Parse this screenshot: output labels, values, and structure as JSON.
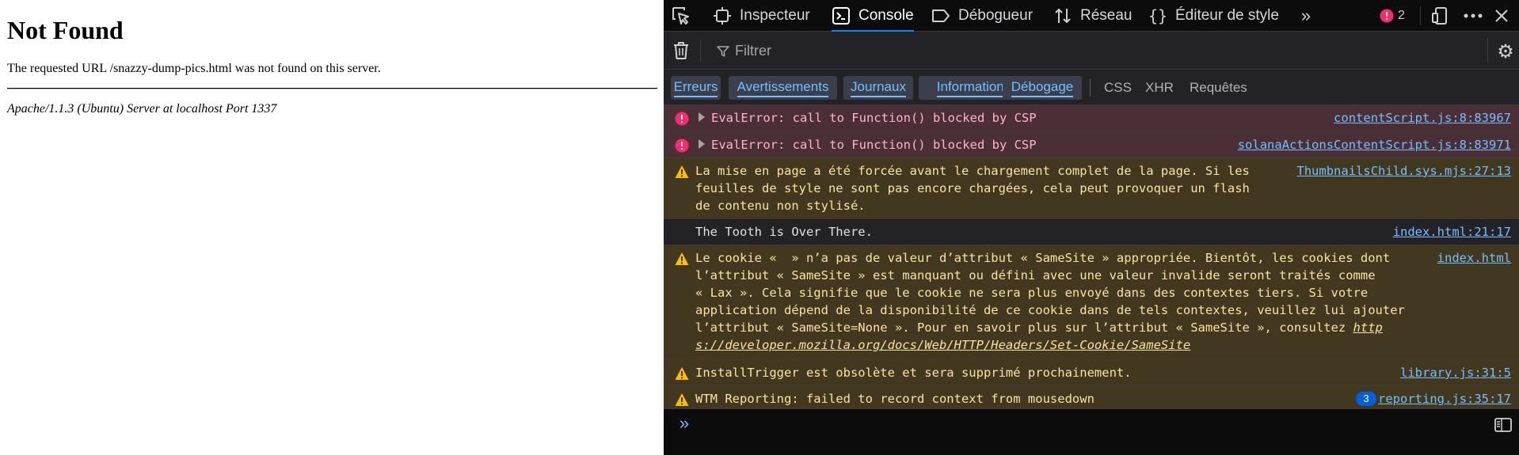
{
  "page": {
    "title": "Not Found",
    "message": "The requested URL /snazzy-dump-pics.html was not found on this server.",
    "address": "Apache/1.1.3 (Ubuntu) Server at localhost Port 1337"
  },
  "devtools": {
    "tabs": [
      {
        "label": "Inspecteur",
        "icon": "inspector-icon"
      },
      {
        "label": "Console",
        "icon": "console-icon",
        "active": true
      },
      {
        "label": "Débogueur",
        "icon": "debugger-icon"
      },
      {
        "label": "Réseau",
        "icon": "network-icon"
      },
      {
        "label": "Éditeur de style",
        "icon": "style-editor-icon"
      }
    ],
    "error_count": "2",
    "filter_placeholder": "Filtrer",
    "categories": [
      "Erreurs",
      "Avertissements",
      "Journaux",
      "Informations",
      "Débogage"
    ],
    "extra_filters": [
      "CSS",
      "XHR",
      "Requêtes"
    ],
    "messages": [
      {
        "level": "error",
        "text": "EvalError: call to Function() blocked by CSP",
        "source": "contentScript.js:8:83967"
      },
      {
        "level": "error",
        "text": "EvalError: call to Function() blocked by CSP",
        "source": "solanaActionsContentScript.js:8:83971"
      },
      {
        "level": "warning",
        "text": "La mise en page a été forcée avant le chargement complet de la page. Si les\nfeuilles de style ne sont pas encore chargées, cela peut provoquer un flash\nde contenu non stylisé.",
        "source": "ThumbnailsChild.sys.mjs:27:13"
      },
      {
        "level": "log",
        "text": "The Tooth is Over There.",
        "source": "index.html:21:17"
      },
      {
        "level": "warning",
        "text": "Le cookie «  » n’a pas de valeur d’attribut « SameSite » appropriée. Bientôt, les cookies dont\nl’attribut « SameSite » est manquant ou défini avec une valeur invalide seront traités comme\n« Lax ». Cela signifie que le cookie ne sera plus envoyé dans des contextes tiers. Si votre\napplication dépend de la disponibilité de ce cookie dans de tels contextes, veuillez lui ajouter\nl’attribut « SameSite=None ». Pour en savoir plus sur l’attribut « SameSite », consultez ",
        "link": "http\ns://developer.mozilla.org/docs/Web/HTTP/Headers/Set-Cookie/SameSite",
        "source": "index.html"
      },
      {
        "level": "warning",
        "text": "InstallTrigger est obsolète et sera supprimé prochainement.",
        "source": "library.js:31:5"
      },
      {
        "level": "warning",
        "text": "WTM Reporting: failed to record context from mousedown",
        "source": "reporting.js:35:17",
        "repeat": "3"
      }
    ],
    "colors": {
      "error_bg": "#4b2f36",
      "warning_bg": "#42381f",
      "accent": "#0a84ff"
    }
  }
}
